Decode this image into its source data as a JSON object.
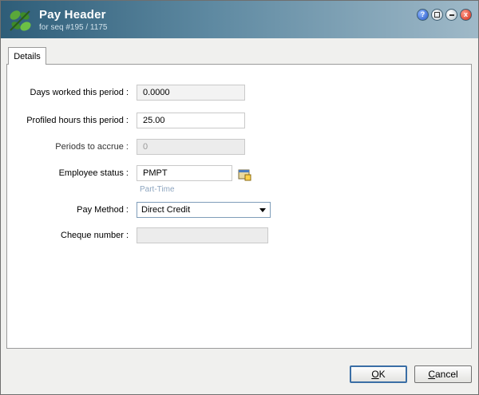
{
  "window": {
    "title": "Pay Header",
    "subtitle": "for seq #195 / 1175"
  },
  "title_buttons": {
    "help": "?",
    "restore": "",
    "minimize": "",
    "close": "x"
  },
  "tabs": [
    {
      "label": "Details"
    }
  ],
  "form": {
    "days_worked": {
      "label": "Days worked this period :",
      "value": "0.0000"
    },
    "profiled_hours": {
      "label": "Profiled hours this period :",
      "value": "25.00"
    },
    "periods_to_accrue": {
      "label": "Periods to accrue :",
      "value": "0"
    },
    "employee_status": {
      "label": "Employee status :",
      "value": "PMPT",
      "hint": "Part-Time"
    },
    "pay_method": {
      "label": "Pay Method :",
      "value": "Direct Credit"
    },
    "cheque_number": {
      "label": "Cheque number :",
      "value": ""
    }
  },
  "buttons": {
    "ok_prefix": "O",
    "ok_rest": "K",
    "cancel_prefix": "C",
    "cancel_rest": "ancel"
  },
  "colors": {
    "title_start": "#2e5d78",
    "title_end": "#9fb9c8",
    "hint": "#8ea6c0"
  },
  "icons": {
    "logo": "app-logo-icon",
    "lookup": "lookup-icon"
  }
}
